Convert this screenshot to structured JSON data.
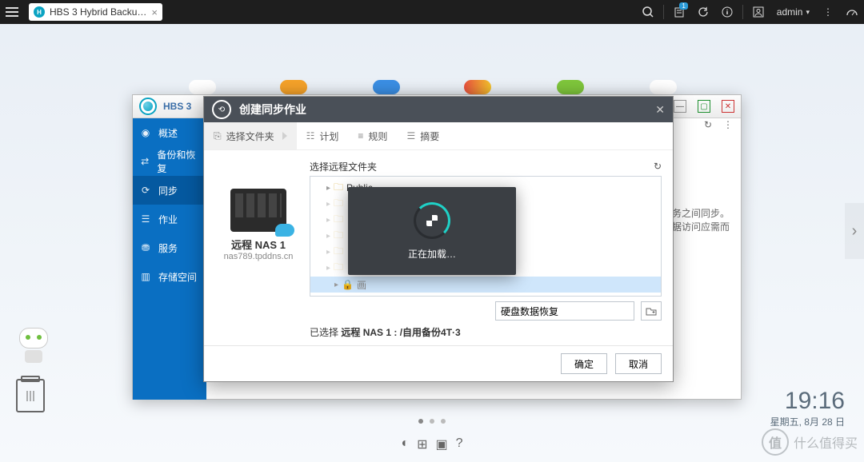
{
  "topbar": {
    "tab_title": "HBS 3 Hybrid Backu…",
    "admin_label": "admin",
    "notif_count": "1"
  },
  "desktop": {
    "time": "19:16",
    "date": "星期五, 8月 28 日",
    "watermark": "什么值得买",
    "watermark_badge": "值"
  },
  "app": {
    "title": "HBS 3",
    "sidebar": [
      {
        "icon": "◉",
        "label": "概述"
      },
      {
        "icon": "⇄",
        "label": "备份和恢复"
      },
      {
        "icon": "⟳",
        "label": "同步"
      },
      {
        "icon": "☰",
        "label": "作业"
      },
      {
        "icon": "⛃",
        "label": "服务"
      },
      {
        "icon": "▥",
        "label": "存储空间"
      }
    ],
    "active_sidebar": 2,
    "hint_right_1": "云服务之间同步。",
    "hint_right_2": "数据访问应需而"
  },
  "dialog": {
    "title": "创建同步作业",
    "tabs": [
      {
        "icon": "⎘",
        "label": "选择文件夹"
      },
      {
        "icon": "☷",
        "label": "计划"
      },
      {
        "icon": "≡",
        "label": "规则"
      },
      {
        "icon": "☰",
        "label": "摘要"
      }
    ],
    "active_tab": 0,
    "nas": {
      "name": "远程 NAS 1",
      "host": "nas789.tpddns.cn"
    },
    "browser_title": "选择远程文件夹",
    "tree": [
      {
        "label": "Public",
        "dim": false
      },
      {
        "label": "",
        "dim": true
      },
      {
        "label": "",
        "dim": true
      },
      {
        "label": "",
        "dim": true
      },
      {
        "label": "",
        "dim": true
      },
      {
        "label": "",
        "dim": true
      }
    ],
    "selected_row": "画",
    "path_input": "硬盘数据恢复",
    "picked_prefix": "已选择",
    "picked_value": "远程 NAS 1 : /自用备份4T·3",
    "ok": "确定",
    "cancel": "取消"
  },
  "loading": "正在加载…"
}
